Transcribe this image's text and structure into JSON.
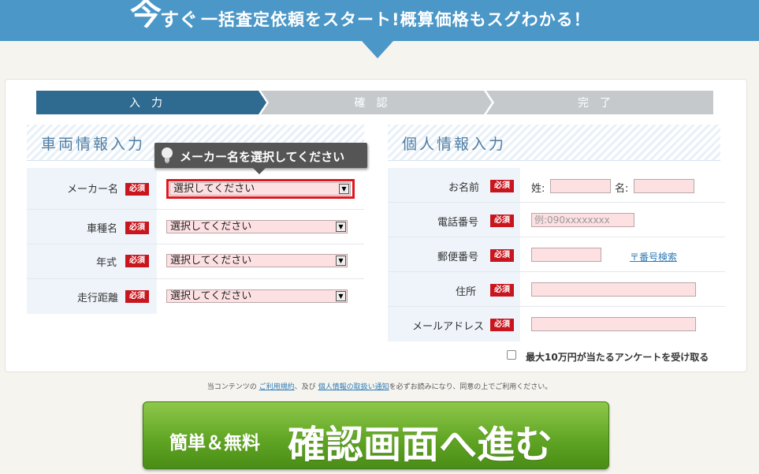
{
  "banner": {
    "ima": "今",
    "sugu": "すぐ",
    "main": "一括査定依頼をスタート!概算価格もスグわかる！"
  },
  "steps": [
    "入力",
    "確認",
    "完了"
  ],
  "vehicle": {
    "title": "車両情報入力",
    "required": "必須",
    "select_placeholder": "選択してください",
    "fields": [
      "メーカー名",
      "車種名",
      "年式",
      "走行距離"
    ]
  },
  "tooltip": {
    "text": "メーカー名を選択してください"
  },
  "personal": {
    "title": "個人情報入力",
    "required": "必須",
    "name_label": "お名前",
    "sei": "姓:",
    "mei": "名:",
    "phone_label": "電話番号",
    "phone_placeholder": "例:090xxxxxxxx",
    "zip_label": "郵便番号",
    "zip_search": "〒番号検索",
    "address_label": "住所",
    "email_label": "メールアドレス"
  },
  "survey": {
    "label": "最大10万円が当たるアンケートを受け取る"
  },
  "terms": {
    "prefix": "当コンテンツの",
    "link1": "ご利用規約",
    "mid": "、及び",
    "link2": "個人情報の取扱い通知",
    "suffix": "を必ずお読みになり、同意の上でご利用ください。"
  },
  "cta": {
    "small": "簡単＆無料",
    "big": "確認画面へ進む"
  },
  "colors": {
    "banner": "#4a97c8",
    "active_step": "#2f6a90",
    "required": "#c8161e",
    "cta": "#5ea322"
  }
}
